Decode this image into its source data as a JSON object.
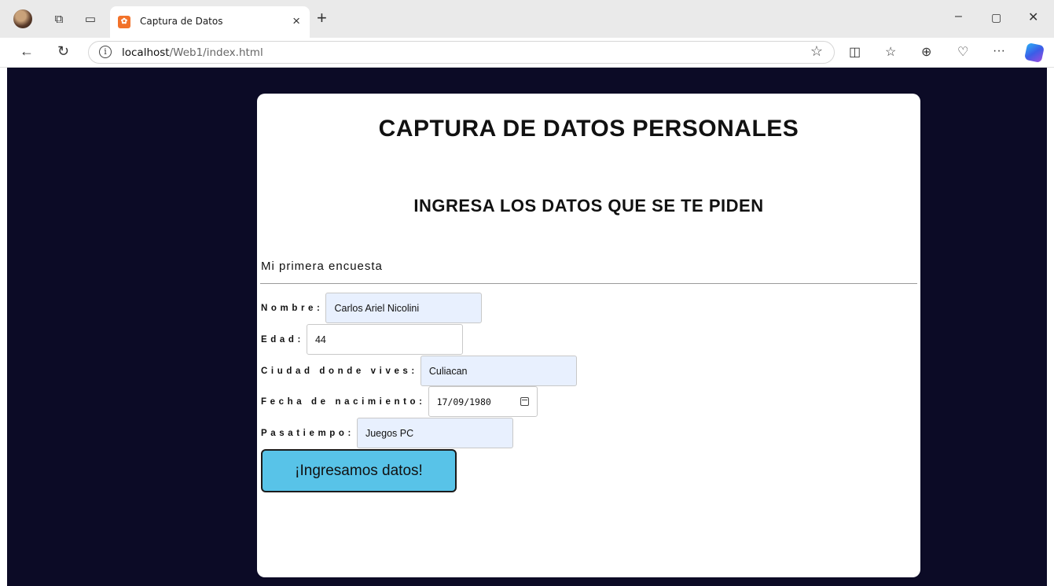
{
  "browser": {
    "tab_title": "Captura de Datos",
    "tab_close": "×",
    "new_tab": "+",
    "url_host": "localhost",
    "url_path": "/Web1/index.html",
    "favicon_letter": "✿",
    "window_buttons": [
      "–",
      "▢",
      "✕"
    ],
    "toolbar_more": "···"
  },
  "page": {
    "title": "CAPTURA DE DATOS PERSONALES",
    "subtitle": "INGRESA LOS DATOS QUE SE TE PIDEN",
    "survey_label": "Mi primera encuesta",
    "fields": {
      "nombre": {
        "label": "Nombre:",
        "value": "Carlos Ariel Nicolini"
      },
      "edad": {
        "label": "Edad:",
        "value": "44"
      },
      "ciudad": {
        "label": "Ciudad donde vives:",
        "value": "Culiacan"
      },
      "fecha": {
        "label": "Fecha de nacimiento:",
        "value": "17/09/1980"
      },
      "pasatiempo": {
        "label": "Pasatiempo:",
        "value": "Juegos PC"
      }
    },
    "submit_label": "¡Ingresamos datos!"
  },
  "colors": {
    "page_background": "#0c0b26",
    "card": "#ffffff",
    "button": "#58c3e8",
    "autofill": "#e8f0fe"
  }
}
